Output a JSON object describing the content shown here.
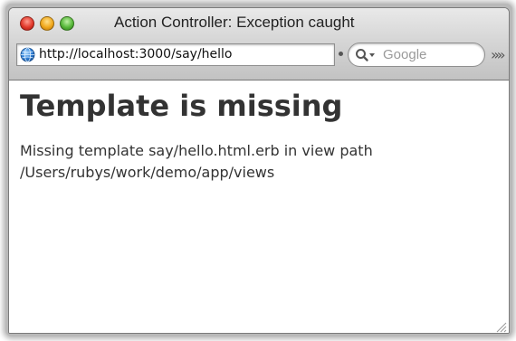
{
  "window": {
    "title": "Action Controller: Exception caught"
  },
  "toolbar": {
    "url": "http://localhost:3000/say/hello",
    "search_placeholder": "Google",
    "overflow_label": "»»"
  },
  "page": {
    "title": "Template is missing",
    "message_line1": "Missing template say/hello.html.erb in view path",
    "message_line2": "/Users/rubys/work/demo/app/views"
  },
  "colors": {
    "close": "#e2392b",
    "minimize": "#f0a81c",
    "zoom": "#57b83a",
    "text": "#333333",
    "placeholder": "#9a9a9a"
  },
  "icons": {
    "site": "globe-icon",
    "search": "search-icon",
    "resize": "resize-grip-icon"
  }
}
